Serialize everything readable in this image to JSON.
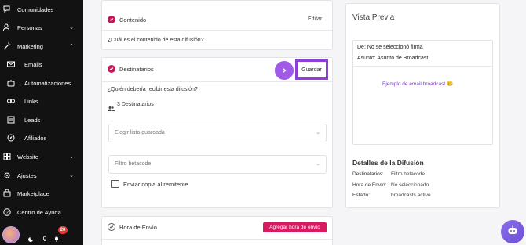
{
  "sidebar": {
    "items": [
      {
        "label": "Comunidades",
        "icon": "chat-bubble-icon"
      },
      {
        "label": "Personas",
        "icon": "people-icon"
      },
      {
        "label": "Marketing",
        "icon": "magic-wand-icon"
      },
      {
        "label": "Emails",
        "icon": "mail-icon"
      },
      {
        "label": "Automatizaciones",
        "icon": "robot-icon"
      },
      {
        "label": "Links",
        "icon": "link-icon"
      },
      {
        "label": "Leads",
        "icon": "list-icon"
      },
      {
        "label": "Afiliados",
        "icon": "compass-icon"
      },
      {
        "label": "Website",
        "icon": "grid-icon"
      },
      {
        "label": "Ajustes",
        "icon": "gear-icon"
      },
      {
        "label": "Marketplace",
        "icon": "bag-icon"
      },
      {
        "label": "Centro de Ayuda",
        "icon": "help-icon"
      }
    ],
    "notification_count": "20"
  },
  "contenido": {
    "title": "Contenido",
    "edit_label": "Editar",
    "question": "¿Cuál es el contenido de esta difusión?"
  },
  "destinatarios": {
    "title": "Destinatarios",
    "save_label": "Guardar",
    "question": "¿Quién debería recibir esta difusión?",
    "count_label": "3 Destinatarios",
    "saved_list_placeholder": "Elegir lista guardada",
    "filter_placeholder": "Filtro betacode",
    "copy_label": "Enviar copia al remitente"
  },
  "envio": {
    "title": "Hora de Envío",
    "add_time_label": "Agregar hora de envío"
  },
  "preview": {
    "title": "Vista Previa",
    "from": "De: No se seleccionó firma",
    "subject": "Asunto: Asunto de Broadcast",
    "example": "Ejemplo de email broadcast 😀"
  },
  "details": {
    "title": "Detalles de la Difusión",
    "rows": [
      {
        "key": "Destinatarios:",
        "value": "Filtro betacode"
      },
      {
        "key": "Hora de Envío:",
        "value": "No seleccionado"
      },
      {
        "key": "Estado:",
        "value": "broadcasts.active"
      }
    ]
  },
  "colors": {
    "accent": "#c2185b",
    "highlight": "#8e3fd9",
    "sidebar": "#121212"
  }
}
